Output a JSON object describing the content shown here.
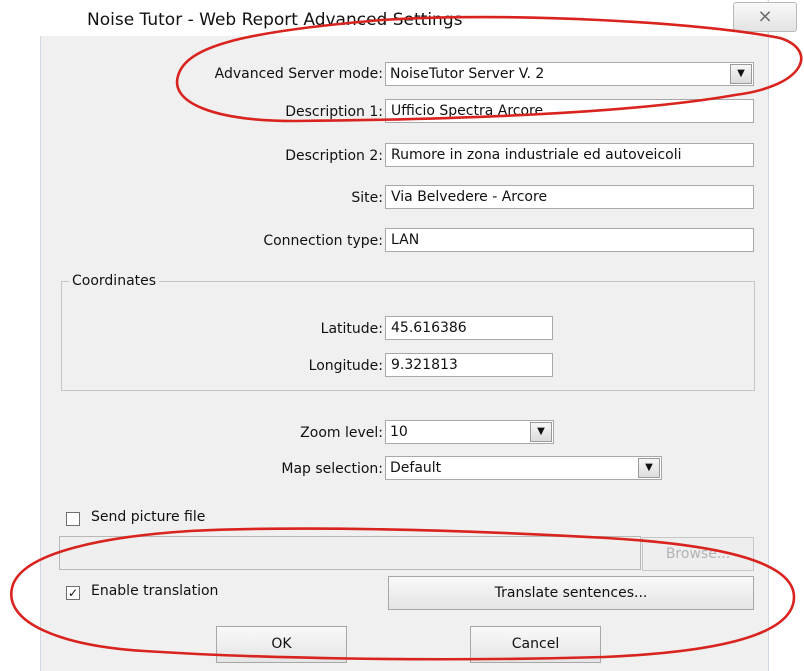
{
  "window": {
    "title": "Noise Tutor - Web Report Advanced Settings",
    "close_glyph": "⨯"
  },
  "form": {
    "advanced_server_mode_label": "Advanced Server mode:",
    "advanced_server_mode_value": "NoiseTutor Server V. 2",
    "description1_label": "Description 1:",
    "description1_value": "Ufficio Spectra Arcore",
    "description2_label": "Description 2:",
    "description2_value": "Rumore in zona industriale ed autoveicoli",
    "site_label": "Site:",
    "site_value": "Via Belvedere - Arcore",
    "connection_type_label": "Connection type:",
    "connection_type_value": "LAN"
  },
  "coordinates": {
    "group_title": "Coordinates",
    "latitude_label": "Latitude:",
    "latitude_value": "45.616386",
    "longitude_label": "Longitude:",
    "longitude_value": "9.321813"
  },
  "map": {
    "zoom_label": "Zoom level:",
    "zoom_value": "10",
    "map_selection_label": "Map selection:",
    "map_selection_value": "Default"
  },
  "options": {
    "send_picture_label": "Send picture file",
    "send_picture_checked": false,
    "browse_label": "Browse...",
    "enable_translation_label": "Enable translation",
    "enable_translation_checked": true,
    "check_glyph": "✓",
    "translate_sentences_label": "Translate sentences..."
  },
  "actions": {
    "ok_label": "OK",
    "cancel_label": "Cancel"
  },
  "icons": {
    "dropdown_glyph": "▼"
  },
  "colors": {
    "annotation_red": "#d9231f",
    "dialog_background": "#f0f0f0"
  }
}
